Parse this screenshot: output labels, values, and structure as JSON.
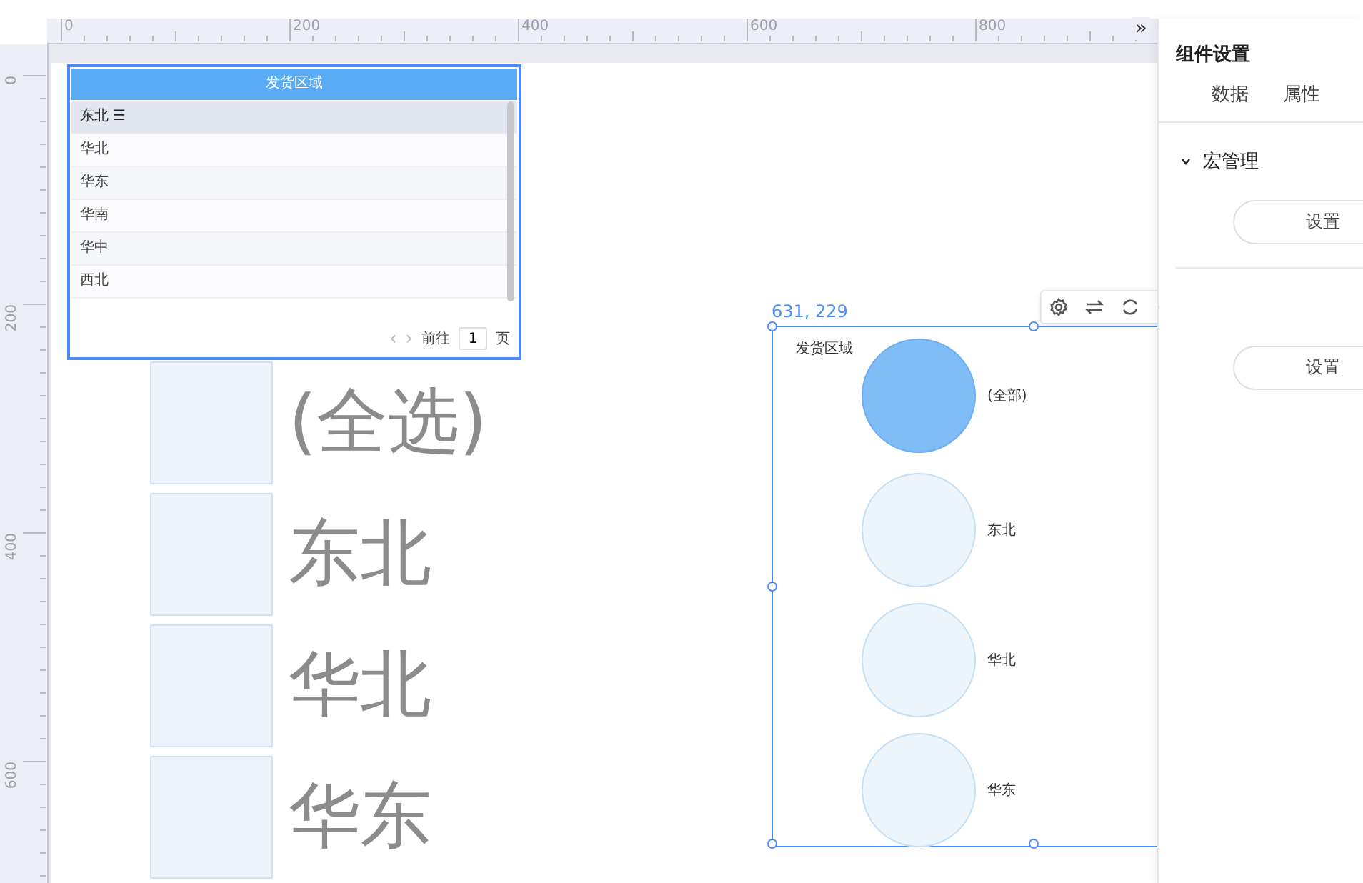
{
  "ruler": {
    "top_labels": [
      "0",
      "200",
      "400",
      "600",
      "800"
    ],
    "left_labels": [
      "0",
      "200",
      "400",
      "600"
    ],
    "expand_glyph": "»"
  },
  "table_widget": {
    "header": "发货区域",
    "rows": [
      {
        "label": "东北",
        "selected": true,
        "menu_glyph": "☰"
      },
      {
        "label": "华北",
        "selected": false
      },
      {
        "label": "华东",
        "selected": false
      },
      {
        "label": "华南",
        "selected": false
      },
      {
        "label": "华中",
        "selected": false
      },
      {
        "label": "西北",
        "selected": false
      }
    ],
    "pagination": {
      "prev": "‹",
      "next": "›",
      "goto_label": "前往",
      "page": "1",
      "page_suffix": "页"
    }
  },
  "checkbox_widget": {
    "items": [
      {
        "label": "(全选)",
        "checked": false
      },
      {
        "label": "东北",
        "checked": false
      },
      {
        "label": "华北",
        "checked": false
      },
      {
        "label": "华东",
        "checked": false
      }
    ]
  },
  "circle_widget": {
    "position": "631, 229",
    "title": "发货区域",
    "items": [
      {
        "label": "(全部)",
        "selected": true
      },
      {
        "label": "东北",
        "selected": false
      },
      {
        "label": "华北",
        "selected": false
      },
      {
        "label": "华东",
        "selected": false
      }
    ]
  },
  "settings_panel": {
    "title": "组件设置",
    "tabs": [
      {
        "label": "数据",
        "selected": false
      },
      {
        "label": "属性",
        "selected": false
      }
    ],
    "section": {
      "label": "宏管理",
      "expanded": true
    },
    "buttons": [
      "设置",
      "设置"
    ]
  }
}
